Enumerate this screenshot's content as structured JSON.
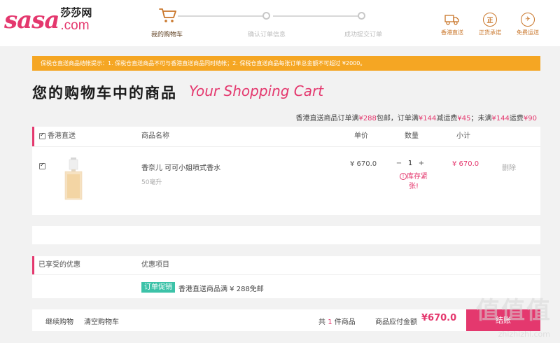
{
  "logo": {
    "brand": "sasa",
    "cn": "莎莎网",
    "com": ".com"
  },
  "steps": [
    {
      "label": "我的购物车",
      "active": true
    },
    {
      "label": "确认订单信息",
      "active": false
    },
    {
      "label": "成功提交订单",
      "active": false
    }
  ],
  "badges": [
    {
      "label": "香港直送",
      "icon": "truck-icon"
    },
    {
      "label": "正货承诺",
      "icon": "genuine-icon",
      "glyph": "正"
    },
    {
      "label": "免费运送",
      "icon": "plane-icon",
      "glyph": "✈"
    }
  ],
  "notice": "保税仓直送商品结帐提示：1. 保税仓直送商品不可与香港直送商品同时结帐；2. 保税仓直送商品每张订单总金额不可超过 ¥2000。",
  "title": {
    "cn": "您的购物车中的商品",
    "en": "Your Shopping Cart"
  },
  "shipping_note": {
    "p1": "香港直送商品订单满",
    "v1": "¥288",
    "p2": "包邮，订单满",
    "v2": "¥144",
    "p3": "减运费",
    "v3": "¥45",
    "p4": "；未满",
    "v4": "¥144",
    "p5": "运费",
    "v5": "¥90"
  },
  "cart": {
    "group_label": "香港直送",
    "columns": {
      "name": "商品名称",
      "price": "单价",
      "qty": "数量",
      "subtotal": "小计"
    },
    "item": {
      "name": "香奈儿 可可小姐喷式香水",
      "spec": "50毫升",
      "price": "¥ 670.0",
      "qty_minus": "−",
      "qty": "1",
      "qty_plus": "+",
      "stock_icon": "!",
      "stock_warning": "库存紧张!",
      "subtotal": "¥ 670.0",
      "delete": "删除"
    }
  },
  "offers": {
    "header_left": "已享受的优惠",
    "header_right": "优惠项目",
    "tag": "订单促销",
    "text": "香港直送商品满 ¥ 288免邮"
  },
  "footer": {
    "continue": "继续购物",
    "clear": "清空购物车",
    "count_prefix": "共",
    "count": "1",
    "count_suffix": "件商品",
    "total_label": "商品应付金额",
    "total": "¥670.0",
    "checkout": "结账"
  },
  "watermark": {
    "big": "值值值",
    "small": "zhizhizhi.com"
  },
  "colors": {
    "brand": "#e4386e",
    "notice": "#f5a623",
    "promo": "#3cc2a8",
    "badge": "#c9762a"
  }
}
